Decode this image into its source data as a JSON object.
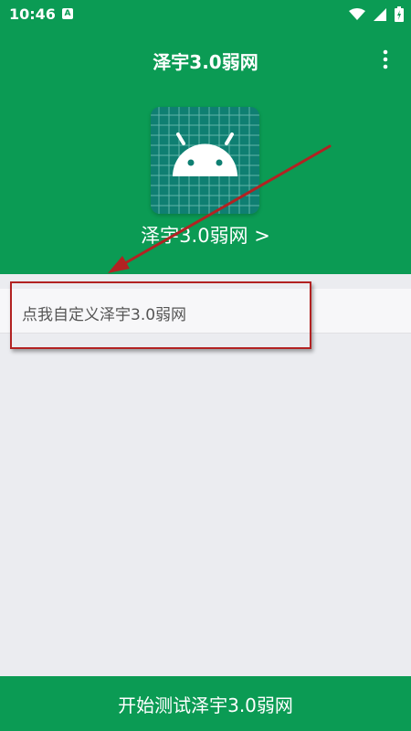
{
  "status_bar": {
    "time": "10:46",
    "notification_icon": "A",
    "icons": [
      "wifi-icon",
      "signal-icon",
      "battery-icon"
    ]
  },
  "toolbar": {
    "title": "泽宇3.0弱网",
    "menu_icon": "more-vert-icon"
  },
  "app": {
    "icon": "android-icon",
    "name": "泽宇3.0弱网 >"
  },
  "list": {
    "custom_item_label": "点我自定义泽宇3.0弱网"
  },
  "footer": {
    "start_button_label": "开始测试泽宇3.0弱网"
  },
  "colors": {
    "brand_green": "#0b9b54",
    "annotation_red": "#b22222",
    "background": "#ebecf0"
  }
}
